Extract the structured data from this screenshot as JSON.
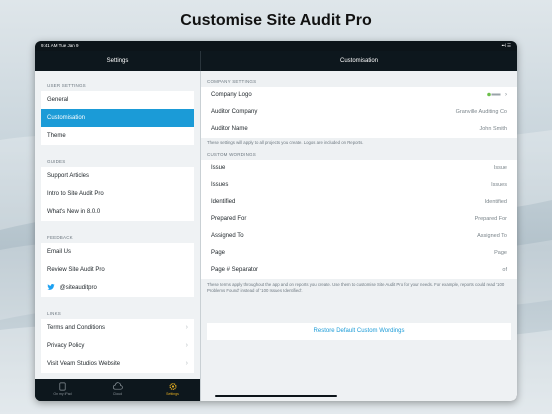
{
  "headline": "Customise Site Audit Pro",
  "status_bar": {
    "time": "9:41 AM   Tue Jan 9",
    "indicators": "••l  ☰"
  },
  "nav": {
    "left_title": "Settings",
    "right_title": "Customisation"
  },
  "sidebar": {
    "user_settings_header": "USER SETTINGS",
    "user_settings": [
      {
        "label": "General"
      },
      {
        "label": "Customisation"
      },
      {
        "label": "Theme"
      }
    ],
    "guides_header": "GUIDES",
    "guides": [
      {
        "label": "Support Articles"
      },
      {
        "label": "Intro to Site Audit Pro"
      },
      {
        "label": "What's New in 8.0.0"
      }
    ],
    "feedback_header": "FEEDBACK",
    "feedback": [
      {
        "label": "Email Us"
      },
      {
        "label": "Review Site Audit Pro"
      },
      {
        "label": "@siteauditpro",
        "icon": "twitter-icon"
      }
    ],
    "links_header": "LINKS",
    "links": [
      {
        "label": "Terms and Conditions"
      },
      {
        "label": "Privacy Policy"
      },
      {
        "label": "Visit Veam Studios Website"
      }
    ]
  },
  "tabbar": {
    "tabs": [
      {
        "label": "On my iPad",
        "icon": "ipad-icon"
      },
      {
        "label": "Cloud",
        "icon": "cloud-icon"
      },
      {
        "label": "Settings",
        "icon": "gear-icon"
      }
    ]
  },
  "main": {
    "company_header": "COMPANY SETTINGS",
    "company": [
      {
        "label": "Company Logo",
        "value": ""
      },
      {
        "label": "Auditor Company",
        "value": "Granville Auditing Co"
      },
      {
        "label": "Auditor Name",
        "value": "John Smith"
      }
    ],
    "company_note": "These settings will apply to all projects you create. Logos are included on Reports.",
    "wordings_header": "CUSTOM WORDINGS",
    "wordings": [
      {
        "label": "Issue",
        "value": "Issue"
      },
      {
        "label": "Issues",
        "value": "Issues"
      },
      {
        "label": "Identified",
        "value": "Identified"
      },
      {
        "label": "Prepared For",
        "value": "Prepared For"
      },
      {
        "label": "Assigned To",
        "value": "Assigned To"
      },
      {
        "label": "Page",
        "value": "Page"
      },
      {
        "label": "Page # Separator",
        "value": "of"
      }
    ],
    "wordings_note": "These terms apply throughout the app and on reports you create. Use them to customise Site Audit Pro for your needs. For example, reports could read '100 Problems Found' instead of '100 Issues Identified'.",
    "restore_label": "Restore Default Custom Wordings"
  },
  "colors": {
    "accent": "#1b9bd7",
    "dark": "#0d171d",
    "tab_active": "#e8b020"
  }
}
